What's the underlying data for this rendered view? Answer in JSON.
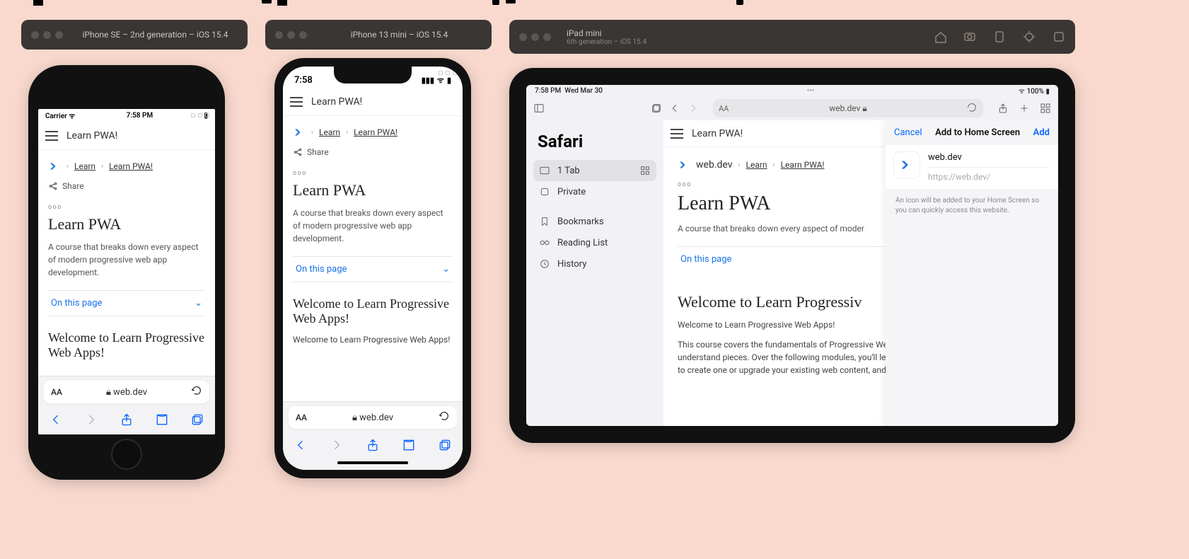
{
  "simulators": {
    "se": {
      "title": "iPhone SE – 2nd generation – iOS 15.4"
    },
    "mini": {
      "title": "iPhone 13 mini – iOS 15.4"
    },
    "ipad": {
      "title": "iPad mini",
      "subtitle": "6th generation – iOS 15.4"
    }
  },
  "status": {
    "se_carrier": "Carrier",
    "se_time": "7:58 PM",
    "mini_time": "7:58",
    "ipad_time": "7:58 PM",
    "ipad_date": "Wed Mar 30",
    "ipad_batt": "100%"
  },
  "page": {
    "app_title": "Learn PWA!",
    "logo_text": "web.dev",
    "crumb_learn": "Learn",
    "crumb_pwa": "Learn PWA!",
    "share": "Share",
    "dots": "ooo",
    "h1": "Learn PWA",
    "desc": "A course that breaks down every aspect of modern progressive web app development.",
    "on_this_page": "On this page",
    "h2": "Welcome to Learn Progressive Web Apps!",
    "h2_ipad": "Welcome to Learn Progressive Web Apps!",
    "p1": "Welcome to Learn Progressive Web Apps!",
    "p_ipad": "This course covers the fundamentals of Progressive Web App development into easy-to-understand pieces. Over the following modules, you'll learn what a Progressive Web App is, how to create one or upgrade your existing web content, and how to add all the pieces for an"
  },
  "safari": {
    "url_short": "web.dev",
    "url_lock": "web.dev",
    "aa": "AA"
  },
  "ipad_sidebar": {
    "title": "Safari",
    "items": [
      {
        "label": "1 Tab",
        "selected": true
      },
      {
        "label": "Private"
      },
      {
        "label": "Bookmarks"
      },
      {
        "label": "Reading List"
      },
      {
        "label": "History"
      }
    ]
  },
  "popover": {
    "cancel": "Cancel",
    "title": "Add to Home Screen",
    "add": "Add",
    "site_name": "web.dev",
    "site_url": "https://web.dev/",
    "note": "An icon will be added to your Home Screen so you can quickly access this website."
  }
}
